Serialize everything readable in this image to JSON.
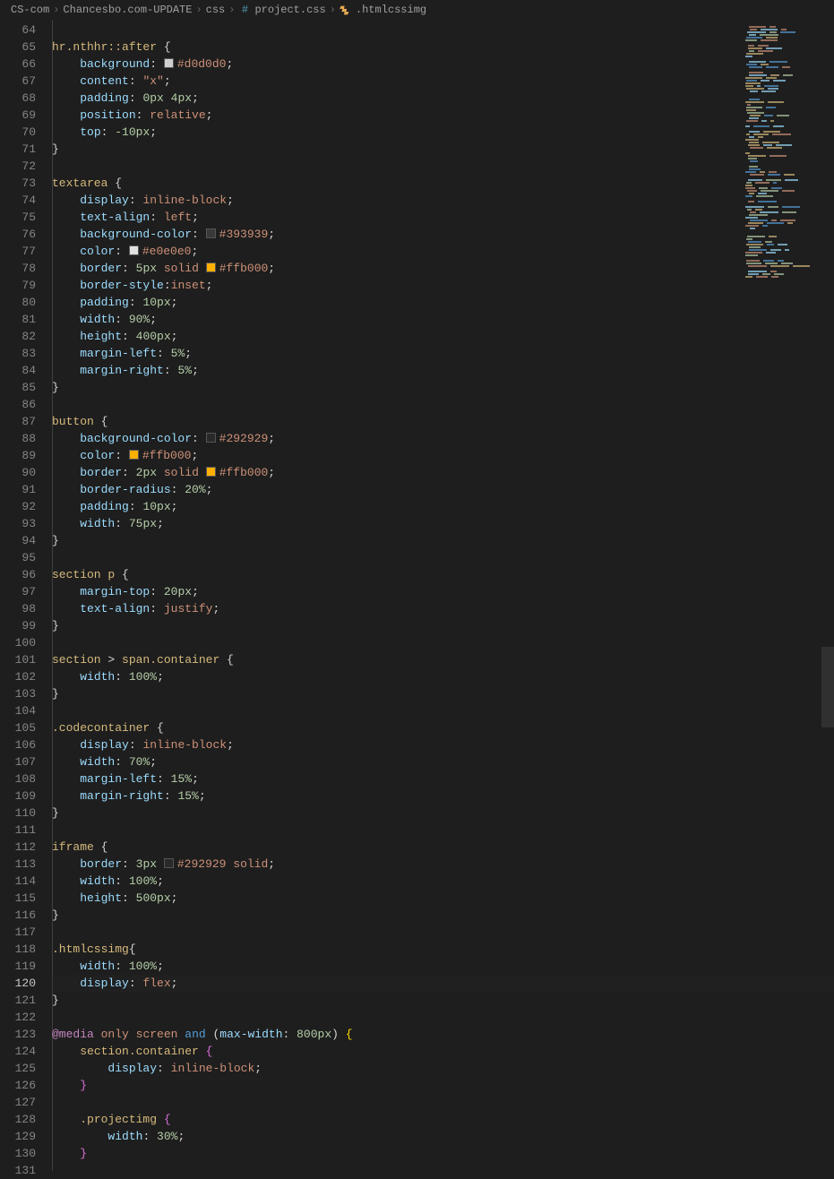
{
  "breadcrumb": {
    "seg1": "CS-com",
    "seg2": "Chancesbo.com-UPDATE",
    "seg3": "css",
    "seg4": "project.css",
    "seg5": ".htmlcssimg"
  },
  "lines": {
    "start": 64,
    "end": 131,
    "current": 120
  },
  "code": {
    "l64": "",
    "l65_sel": "hr.nthhr",
    "l65_pseudo": "::after",
    "l65_brace": " {",
    "l66_prop": "background",
    "l66_colon": ": ",
    "l66_color": "#d0d0d0",
    "l66_swatch": "#d0d0d0",
    "l67_prop": "content",
    "l67_val": "\"x\"",
    "l68_prop": "padding",
    "l68_v1": "0px",
    "l68_v2": "4px",
    "l69_prop": "position",
    "l69_val": "relative",
    "l70_prop": "top",
    "l70_val": "-10px",
    "l71_brace": "}",
    "l73_sel": "textarea",
    "l73_brace": " {",
    "l74_prop": "display",
    "l74_val": "inline-block",
    "l75_prop": "text-align",
    "l75_val": "left",
    "l76_prop": "background-color",
    "l76_color": "#393939",
    "l76_swatch": "#393939",
    "l77_prop": "color",
    "l77_color": "#e0e0e0",
    "l77_swatch": "#e0e0e0",
    "l78_prop": "border",
    "l78_v1": "5px",
    "l78_v2": "solid",
    "l78_color": "#ffb000",
    "l78_swatch": "#ffb000",
    "l79_prop": "border-style",
    "l79_val": "inset",
    "l80_prop": "padding",
    "l80_val": "10px",
    "l81_prop": "width",
    "l81_val": "90%",
    "l82_prop": "height",
    "l82_val": "400px",
    "l83_prop": "margin-left",
    "l83_val": "5%",
    "l84_prop": "margin-right",
    "l84_val": "5%",
    "l85_brace": "}",
    "l87_sel": "button",
    "l87_brace": " {",
    "l88_prop": "background-color",
    "l88_color": "#292929",
    "l88_swatch": "#292929",
    "l89_prop": "color",
    "l89_color": "#ffb000",
    "l89_swatch": "#ffb000",
    "l90_prop": "border",
    "l90_v1": "2px",
    "l90_v2": "solid",
    "l90_color": "#ffb000",
    "l90_swatch": "#ffb000",
    "l91_prop": "border-radius",
    "l91_val": "20%",
    "l92_prop": "padding",
    "l92_val": "10px",
    "l93_prop": "width",
    "l93_val": "75px",
    "l94_brace": "}",
    "l96_sel1": "section",
    "l96_sel2": "p",
    "l96_brace": " {",
    "l97_prop": "margin-top",
    "l97_val": "20px",
    "l98_prop": "text-align",
    "l98_val": "justify",
    "l99_brace": "}",
    "l101_sel1": "section",
    "l101_gt": " > ",
    "l101_sel2": "span",
    "l101_class": ".container",
    "l101_brace": " {",
    "l102_prop": "width",
    "l102_val": "100%",
    "l103_brace": "}",
    "l105_sel": ".codecontainer",
    "l105_brace": " {",
    "l106_prop": "display",
    "l106_val": "inline-block",
    "l107_prop": "width",
    "l107_val": "70%",
    "l108_prop": "margin-left",
    "l108_val": "15%",
    "l109_prop": "margin-right",
    "l109_val": "15%",
    "l110_brace": "}",
    "l112_sel": "iframe",
    "l112_brace": " {",
    "l113_prop": "border",
    "l113_v1": "3px",
    "l113_color": "#292929",
    "l113_swatch": "#292929",
    "l113_v3": "solid",
    "l114_prop": "width",
    "l114_val": "100%",
    "l115_prop": "height",
    "l115_val": "500px",
    "l116_brace": "}",
    "l118_sel": ".htmlcssimg",
    "l118_brace": "{",
    "l119_prop": "width",
    "l119_val": "100%",
    "l120_prop": "display",
    "l120_val": "flex",
    "l121_brace": "}",
    "l123_kw1": "@media",
    "l123_kw2": "only",
    "l123_kw3": "screen",
    "l123_kw4": "and",
    "l123_func": "max-width",
    "l123_arg": "800px",
    "l123_brace": " {",
    "l124_sel1": "section",
    "l124_class": ".container",
    "l124_brace": " {",
    "l125_prop": "display",
    "l125_val": "inline-block",
    "l126_brace": "}",
    "l128_sel": ".projectimg",
    "l128_brace": " {",
    "l129_prop": "width",
    "l129_val": "30%",
    "l130_brace": "}"
  }
}
